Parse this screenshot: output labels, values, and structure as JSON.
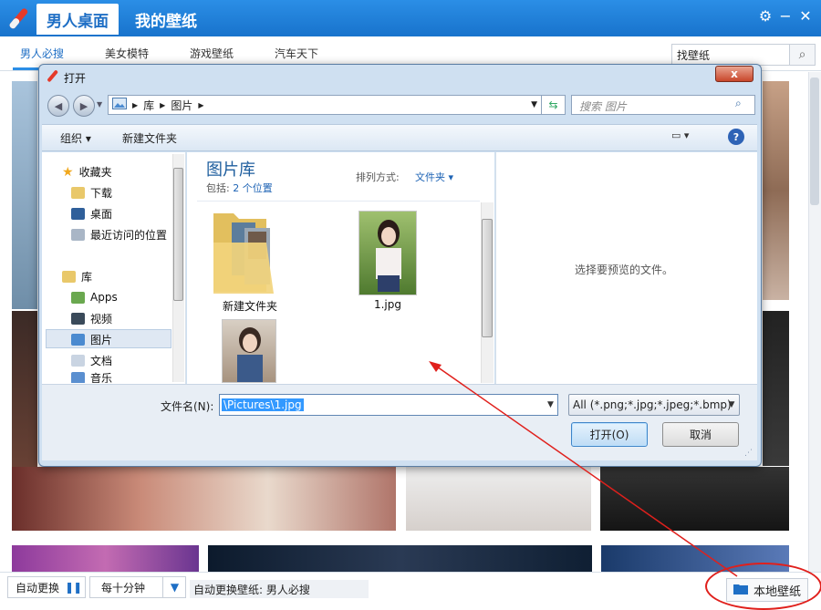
{
  "app": {
    "tab_active": "男人桌面",
    "tab_other": "我的壁纸",
    "categories": [
      "男人必搜",
      "美女模特",
      "游戏壁纸",
      "汽车天下"
    ],
    "search_value": "找壁纸",
    "colors": {
      "titlebar": "#1f7fd8",
      "accent": "#2b8ee6",
      "annotation": "#e0201c"
    }
  },
  "bottom": {
    "auto_change": "自动更换",
    "interval": "每十分钟",
    "auto_status": "自动更换壁纸: 男人必搜",
    "local_wallpaper": "本地壁纸"
  },
  "dialog": {
    "title": "打开",
    "close": "x",
    "breadcrumb": [
      "库",
      "图片"
    ],
    "search_placeholder": "搜索 图片",
    "toolbar": {
      "organize": "组织 ▾",
      "new_folder": "新建文件夹",
      "help": "?"
    },
    "nav": {
      "favorites": "收藏夹",
      "downloads": "下载",
      "desktop": "桌面",
      "recent": "最近访问的位置",
      "libraries": "库",
      "apps": "Apps",
      "videos": "视频",
      "pictures": "图片",
      "documents": "文档",
      "music": "音乐"
    },
    "library_title": "图片库",
    "library_includes": "包括:",
    "library_locations": "2 个位置",
    "arrange_label": "排列方式:",
    "arrange_value": "文件夹 ▾",
    "files": [
      {
        "name": "新建文件夹",
        "type": "folder-icon"
      },
      {
        "name": "1.jpg",
        "type": "image-thumb"
      },
      {
        "name": "",
        "type": "image-thumb"
      }
    ],
    "preview_text": "选择要预览的文件。",
    "filename_label": "文件名(N):",
    "filename_value": "\\Pictures\\1.jpg",
    "filetype_value": "All (*.png;*.jpg;*.jpeg;*.bmp)",
    "open_button": "打开(O)",
    "cancel_button": "取消"
  }
}
